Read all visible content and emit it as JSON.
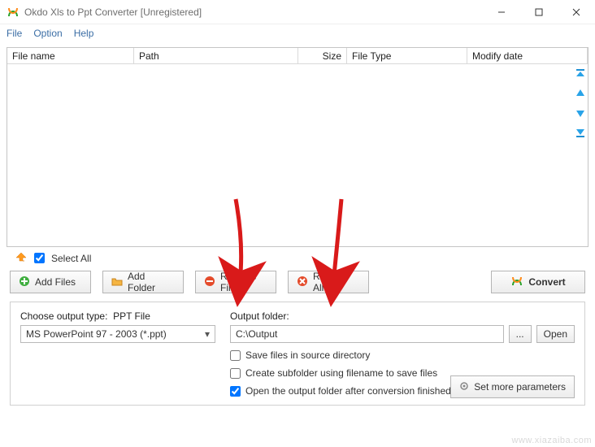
{
  "window": {
    "title": "Okdo Xls to Ppt Converter [Unregistered]"
  },
  "menu": {
    "file": "File",
    "option": "Option",
    "help": "Help"
  },
  "columns": {
    "filename": "File name",
    "path": "Path",
    "size": "Size",
    "filetype": "File Type",
    "modify": "Modify date"
  },
  "select_all": {
    "label": "Select All",
    "checked": true
  },
  "buttons": {
    "add_files": "Add Files",
    "add_folder": "Add Folder",
    "remove_file": "Remove File",
    "remove_all": "Remove All",
    "convert": "Convert",
    "browse": "...",
    "open": "Open",
    "set_more": "Set more parameters"
  },
  "output_type": {
    "label": "Choose output type:",
    "typename": "PPT File",
    "value": "MS PowerPoint 97 - 2003 (*.ppt)"
  },
  "output_folder": {
    "label": "Output folder:",
    "value": "C:\\Output"
  },
  "options": {
    "save_in_source": {
      "label": "Save files in source directory",
      "checked": false
    },
    "create_subfolder": {
      "label": "Create subfolder using filename to save files",
      "checked": false
    },
    "open_after": {
      "label": "Open the output folder after conversion finished",
      "checked": true
    }
  },
  "watermark": "www.xiazaiba.com"
}
